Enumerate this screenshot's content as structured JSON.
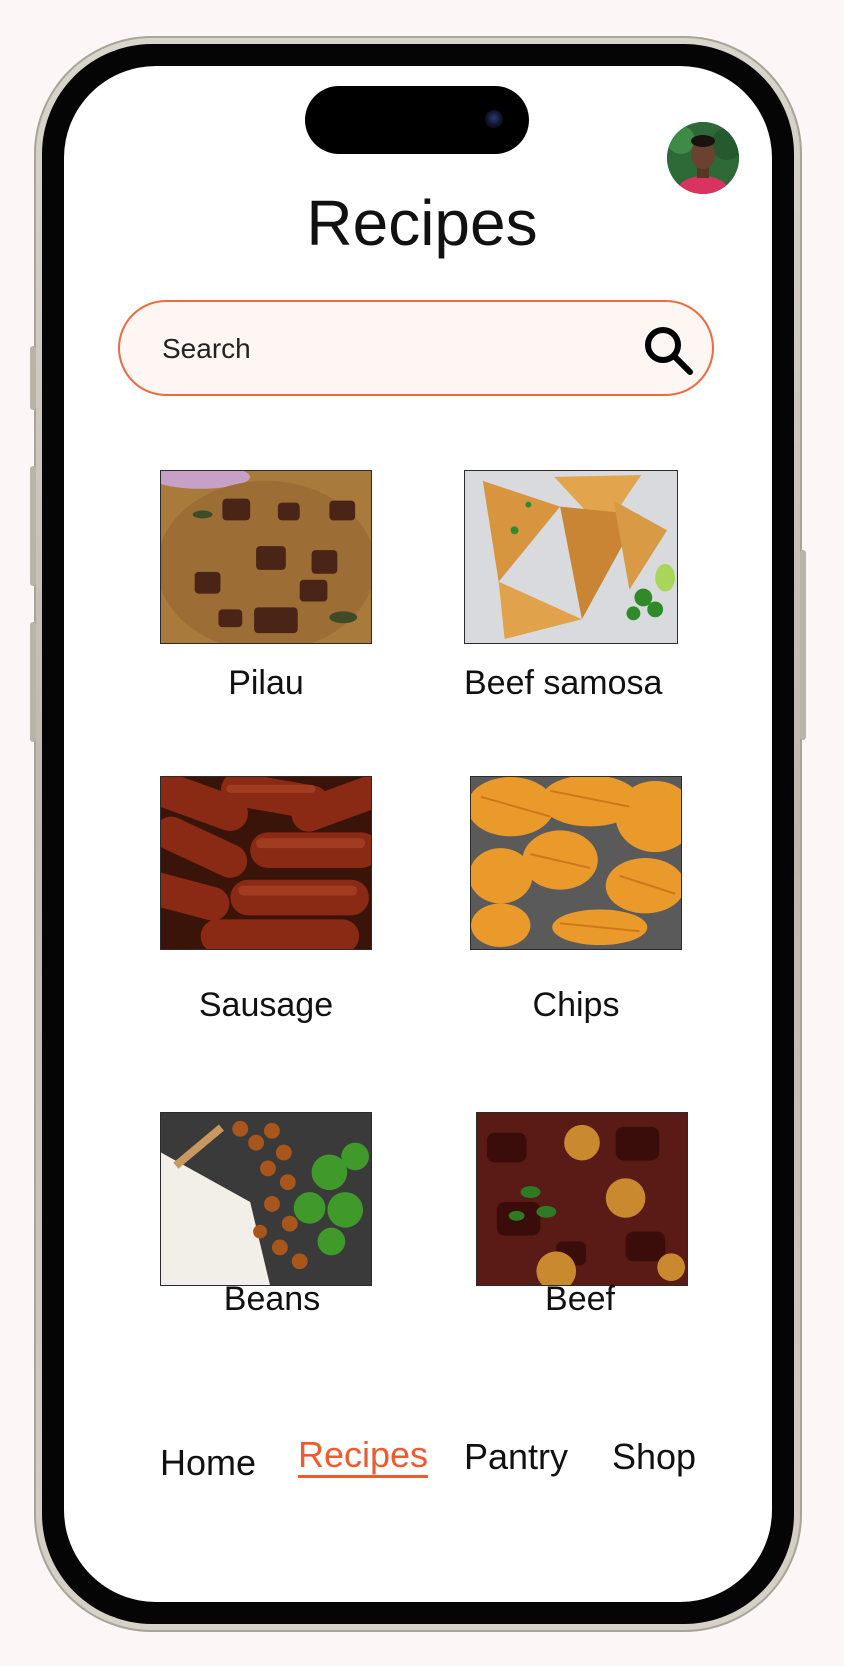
{
  "header": {
    "title": "Recipes",
    "avatar_alt": "profile picture"
  },
  "search": {
    "placeholder": "Search",
    "icon": "search-icon"
  },
  "recipes": [
    {
      "name": "Pilau",
      "image": "pilau rice with beef"
    },
    {
      "name": "Beef samosa",
      "image": "samosas"
    },
    {
      "name": "Sausage",
      "image": "grilled sausages"
    },
    {
      "name": "Chips",
      "image": "ridged potato chips"
    },
    {
      "name": "Beans",
      "image": "beans, rice and broccoli"
    },
    {
      "name": "Beef",
      "image": "beef stew"
    }
  ],
  "bottom_nav": {
    "items": [
      {
        "label": "Home",
        "active": false
      },
      {
        "label": "Recipes",
        "active": true
      },
      {
        "label": "Pantry",
        "active": false
      },
      {
        "label": "Shop",
        "active": false
      }
    ]
  },
  "colors": {
    "accent": "#f25a2e",
    "search_border": "#f06a3e",
    "background": "#fcf7f6"
  }
}
